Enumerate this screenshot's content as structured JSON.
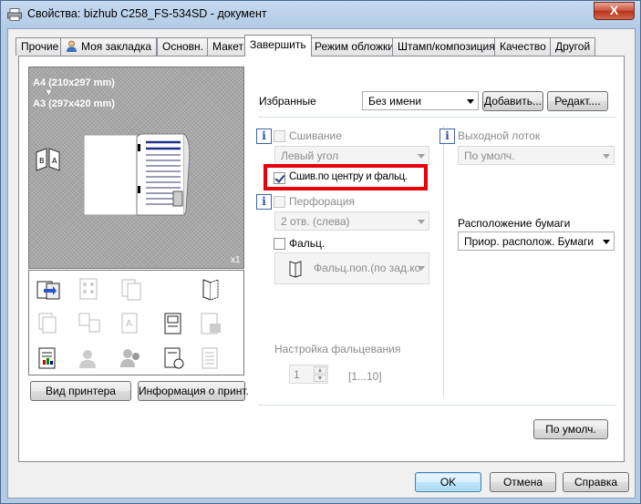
{
  "window": {
    "title": "Свойства: bizhub C258_FS-534SD - документ",
    "close_glyph": "X"
  },
  "tabs": [
    {
      "label": "Прочие"
    },
    {
      "label": "Моя закладка"
    },
    {
      "label": "Основн."
    },
    {
      "label": "Макет"
    },
    {
      "label": "Завершить",
      "active": true
    },
    {
      "label": "Режим обложки"
    },
    {
      "label": "Штамп/композиция"
    },
    {
      "label": "Качество"
    },
    {
      "label": "Другой"
    }
  ],
  "preview": {
    "paper_a4": "A4 (210x297 mm)",
    "paper_arrow": "▼",
    "paper_a3": "A3 (297x420 mm)",
    "copies": "x1",
    "printer_view_button": "Вид принтера",
    "printer_info_button": "Информация о принт."
  },
  "favorites": {
    "label": "Избранные",
    "value": "Без имени",
    "add_button": "Добавить...",
    "edit_button": "Редакт...."
  },
  "staple": {
    "label": "Сшивание",
    "value": "Левый угол",
    "checked": false,
    "enabled": false
  },
  "center_staple": {
    "label": "Сшив.по центру и фальц.",
    "checked": true,
    "highlight_color": "#e8000b"
  },
  "punch": {
    "label": "Перфорация",
    "value": "2 отв. (слева)",
    "checked": false,
    "enabled": false
  },
  "fold": {
    "label": "Фальц.",
    "value": "Фальц.поп.(по зад.ко",
    "checked": false
  },
  "fold_settings": {
    "label": "Настройка фальцевания",
    "value": "1",
    "range": "[1...10]"
  },
  "output_tray": {
    "label": "Выходной лоток",
    "value": "По умолч.",
    "enabled": false
  },
  "paper_arrangement": {
    "label": "Расположение бумаги",
    "value": "Приор. располож. Бумаги"
  },
  "defaults_button": "По умолч.",
  "footer": {
    "ok": "OK",
    "cancel": "Отмена",
    "help": "Справка"
  }
}
